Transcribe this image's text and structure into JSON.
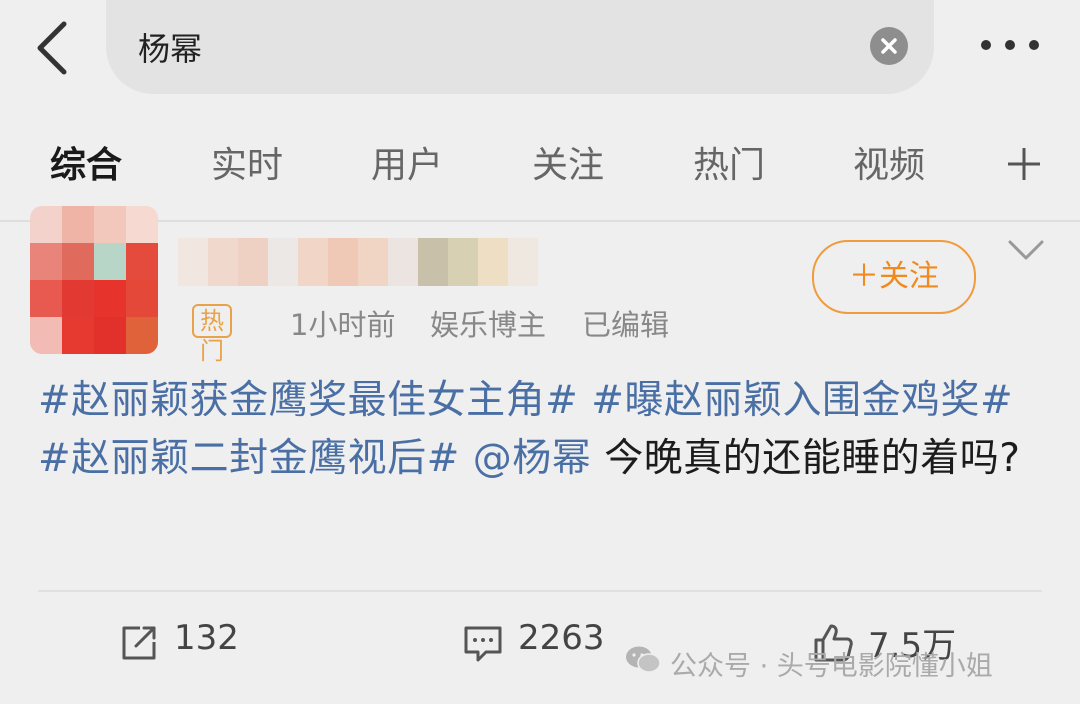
{
  "header": {
    "search_query": "杨幂"
  },
  "tabs": [
    {
      "label": "综合",
      "active": true
    },
    {
      "label": "实时",
      "active": false
    },
    {
      "label": "用户",
      "active": false
    },
    {
      "label": "关注",
      "active": false
    },
    {
      "label": "热门",
      "active": false
    },
    {
      "label": "视频",
      "active": false
    }
  ],
  "post": {
    "badge": "热门",
    "time": "1小时前",
    "author_role": "娱乐博主",
    "edited": "已编辑",
    "follow_label": "＋关注",
    "tags": [
      "#赵丽颖获金鹰奖最佳女主角#",
      "#曝赵丽颖入围金鸡奖#",
      "#赵丽颖二封金鹰视后#"
    ],
    "mention": "@杨幂",
    "body": "今晚真的还能睡的着吗?"
  },
  "actions": {
    "share_count": "132",
    "comment_count": "2263",
    "like_count": "7.5万"
  },
  "watermark": {
    "text": "公众号 · 头号电影院懂小姐"
  },
  "colors": {
    "link": "#4a6fa5",
    "follow_accent": "#f08a1c",
    "badge": "#e8a34a",
    "background": "#efefef"
  }
}
